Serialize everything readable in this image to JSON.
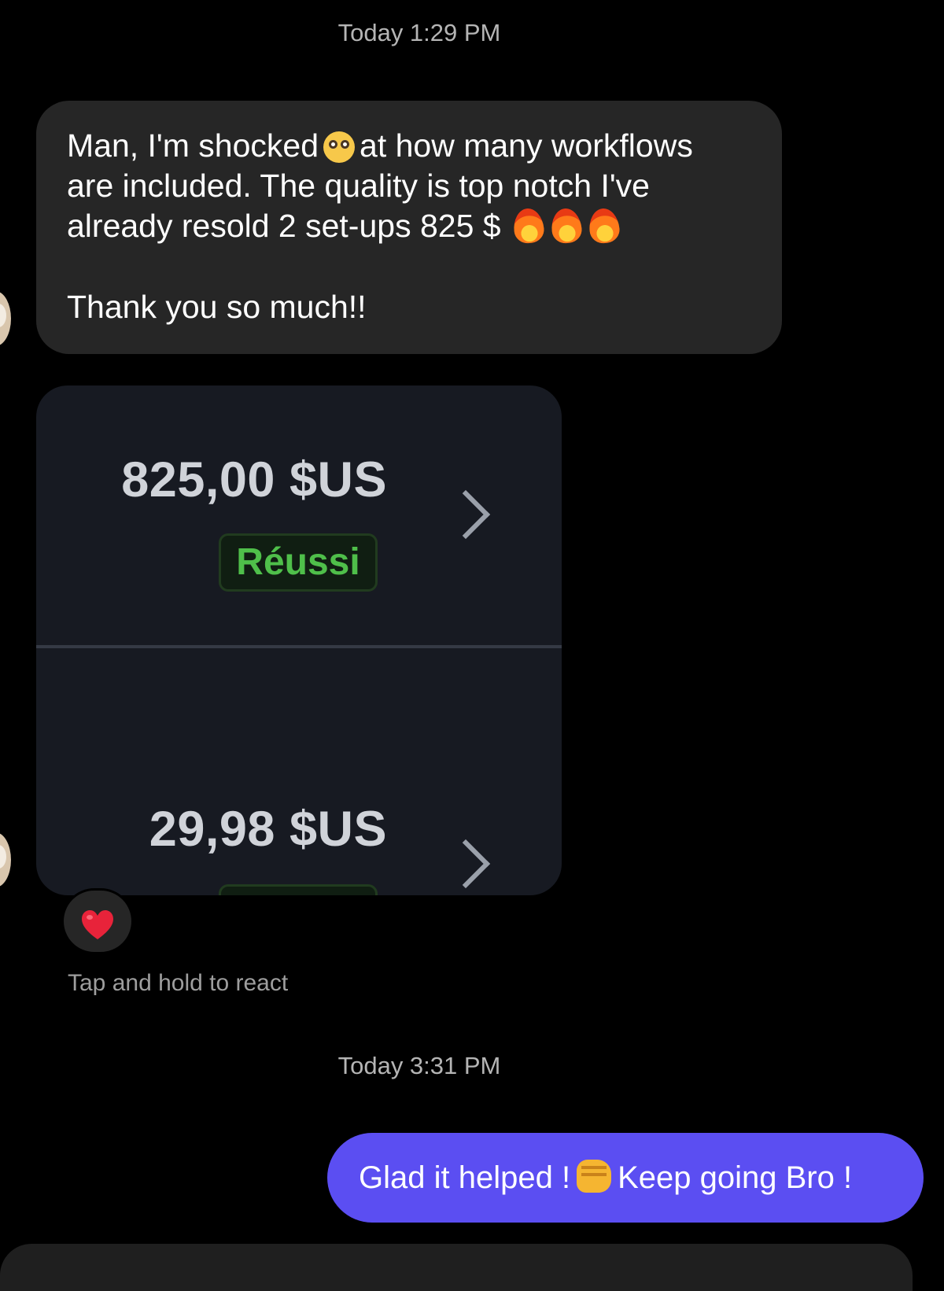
{
  "chat": {
    "timestamp_1": "Today 1:29 PM",
    "timestamp_2": "Today 3:31 PM",
    "received_message": {
      "line1_a": "Man, I'm shocked",
      "line1_b": "at how many workflows",
      "line2": "are included. The quality is top notch I've",
      "line3": "already resold 2 set-ups  825 $",
      "line4": "Thank you so much!!",
      "emojis": [
        "flushed-face-emoji",
        "fire-emoji",
        "fire-emoji",
        "fire-emoji"
      ]
    },
    "image_attachment": {
      "transactions": [
        {
          "amount": "825,00 $US",
          "status": "Réussi"
        },
        {
          "amount": "29,98 $US"
        }
      ],
      "status_color": "#4fbf4a"
    },
    "reaction": {
      "emoji": "red-heart-emoji",
      "hint": "Tap and hold to react"
    },
    "sent_message": {
      "part_a": "Glad it helped !",
      "part_b": "Keep going Bro !",
      "emoji": "oncoming-fist-emoji",
      "bubble_color": "#5b4ef2"
    }
  }
}
